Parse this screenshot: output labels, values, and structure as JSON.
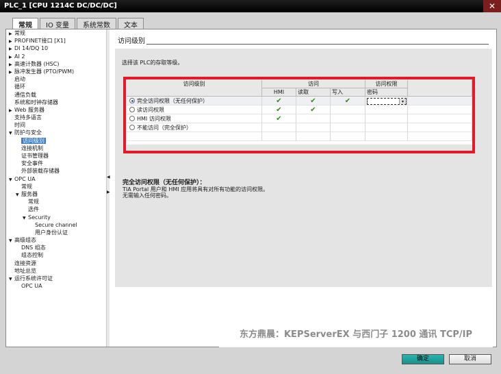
{
  "window": {
    "title": "PLC_1 [CPU 1214C DC/DC/DC]",
    "close_glyph": "✕"
  },
  "tabs": [
    "常规",
    "IO 变量",
    "系统常数",
    "文本"
  ],
  "tree": [
    {
      "label": "常规",
      "arrow": "▶",
      "level": 0
    },
    {
      "label": "PROFINET接口 [X1]",
      "arrow": "▶",
      "level": 0
    },
    {
      "label": "DI 14/DQ 10",
      "arrow": "▶",
      "level": 0
    },
    {
      "label": "AI 2",
      "arrow": "▶",
      "level": 0
    },
    {
      "label": "高速计数器 (HSC)",
      "arrow": "▶",
      "level": 0
    },
    {
      "label": "脉冲发生器 (PTO/PWM)",
      "arrow": "▶",
      "level": 0
    },
    {
      "label": "启动",
      "arrow": "",
      "level": 0
    },
    {
      "label": "循环",
      "arrow": "",
      "level": 0
    },
    {
      "label": "通信负载",
      "arrow": "",
      "level": 0
    },
    {
      "label": "系统和时钟存储器",
      "arrow": "",
      "level": 0
    },
    {
      "label": "Web 服务器",
      "arrow": "▶",
      "level": 0
    },
    {
      "label": "支持多语言",
      "arrow": "",
      "level": 0
    },
    {
      "label": "时间",
      "arrow": "",
      "level": 0
    },
    {
      "label": "防护与安全",
      "arrow": "▼",
      "level": 0
    },
    {
      "label": "访问级别",
      "arrow": "",
      "level": 1,
      "selected": true
    },
    {
      "label": "连接机制",
      "arrow": "",
      "level": 1
    },
    {
      "label": "证书管理器",
      "arrow": "",
      "level": 1
    },
    {
      "label": "安全事件",
      "arrow": "",
      "level": 1
    },
    {
      "label": "外部装载存储器",
      "arrow": "",
      "level": 1
    },
    {
      "label": "OPC UA",
      "arrow": "▼",
      "level": 0
    },
    {
      "label": "常规",
      "arrow": "",
      "level": 1
    },
    {
      "label": "服务器",
      "arrow": "▼",
      "level": 1
    },
    {
      "label": "常规",
      "arrow": "",
      "level": 2
    },
    {
      "label": "选件",
      "arrow": "",
      "level": 2
    },
    {
      "label": "Security",
      "arrow": "▼",
      "level": 2
    },
    {
      "label": "Secure channel",
      "arrow": "",
      "level": 3
    },
    {
      "label": "用户身份认证",
      "arrow": "",
      "level": 3
    },
    {
      "label": "高级组态",
      "arrow": "▼",
      "level": 0
    },
    {
      "label": "DNS 组态",
      "arrow": "",
      "level": 1
    },
    {
      "label": "组态控制",
      "arrow": "",
      "level": 1
    },
    {
      "label": "连接资源",
      "arrow": "",
      "level": 0
    },
    {
      "label": "地址总览",
      "arrow": "",
      "level": 0
    },
    {
      "label": "运行系统许可证",
      "arrow": "▼",
      "level": 0
    },
    {
      "label": "OPC UA",
      "arrow": "",
      "level": 1
    }
  ],
  "section": {
    "title": "访问级别",
    "description": "选择该 PLC的存取等级。"
  },
  "grid": {
    "headers": {
      "level": "访问级别",
      "access": "访问",
      "permission": "访问权限",
      "hmi": "HMI",
      "read": "读取",
      "write": "写入",
      "password": "密码"
    },
    "rows": [
      {
        "label": "完全访问权限（无任何保护）",
        "selected": true,
        "hmi": true,
        "read": true,
        "write": true
      },
      {
        "label": "读访问权限",
        "selected": false,
        "hmi": true,
        "read": true,
        "write": false
      },
      {
        "label": "HMI 访问权限",
        "selected": false,
        "hmi": true,
        "read": false,
        "write": false
      },
      {
        "label": "不能访问（完全保护）",
        "selected": false,
        "hmi": false,
        "read": false,
        "write": false
      }
    ],
    "check_glyph": "✔"
  },
  "info": {
    "title": "完全访问权限（无任何保护）：",
    "line1": "TIA Portal 用户和 HMI 应用将具有对所有功能的访问权限。",
    "line2": "无需输入任何密码。"
  },
  "watermark": "东方鼎晨：KEPServerEX 与西门子 1200 通讯 TCP/IP",
  "buttons": {
    "ok": "确定",
    "cancel": "取消"
  },
  "colors": {
    "highlight": "#e4192a",
    "selection": "#3c7bc6",
    "check": "#2e8b1f",
    "ok_button": "#1a8f8a"
  }
}
